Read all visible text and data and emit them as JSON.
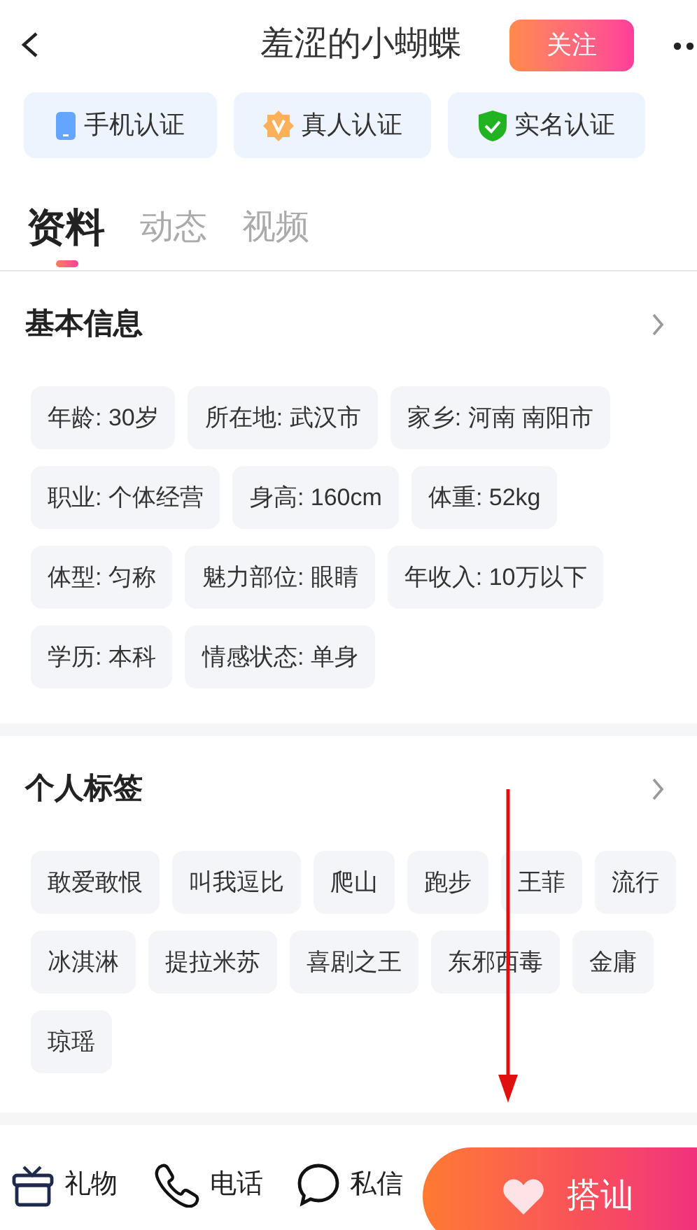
{
  "header": {
    "title": "羞涩的小蝴蝶",
    "follow_button": "关注"
  },
  "badges": [
    {
      "kind": "phone",
      "label": "手机认证"
    },
    {
      "kind": "real",
      "label": "真人认证"
    },
    {
      "kind": "name",
      "label": "实名认证"
    }
  ],
  "tabs": [
    {
      "label": "资料",
      "selected": true
    },
    {
      "label": "动态",
      "selected": false
    },
    {
      "label": "视频",
      "selected": false
    }
  ],
  "sections": [
    {
      "title": "基本信息",
      "tags": [
        "年龄: 30岁",
        "所在地: 武汉市",
        "家乡: 河南 南阳市",
        "职业: 个体经营",
        "身高: 160cm",
        "体重: 52kg",
        "体型: 匀称",
        "魅力部位: 眼睛",
        "年收入: 10万以下",
        "学历: 本科",
        "情感状态: 单身"
      ]
    },
    {
      "title": "个人标签",
      "tags": [
        "敢爱敢恨",
        "叫我逗比",
        "爬山",
        "跑步",
        "王菲",
        "流行",
        "冰淇淋",
        "提拉米苏",
        "喜剧之王",
        "东邪西毒",
        "金庸",
        "琼瑶"
      ]
    }
  ],
  "bottom_bar": {
    "actions": [
      {
        "kind": "gift",
        "label": "礼物"
      },
      {
        "kind": "phone",
        "label": "电话"
      },
      {
        "kind": "chat",
        "label": "私信"
      }
    ],
    "primary_button": "搭讪"
  }
}
